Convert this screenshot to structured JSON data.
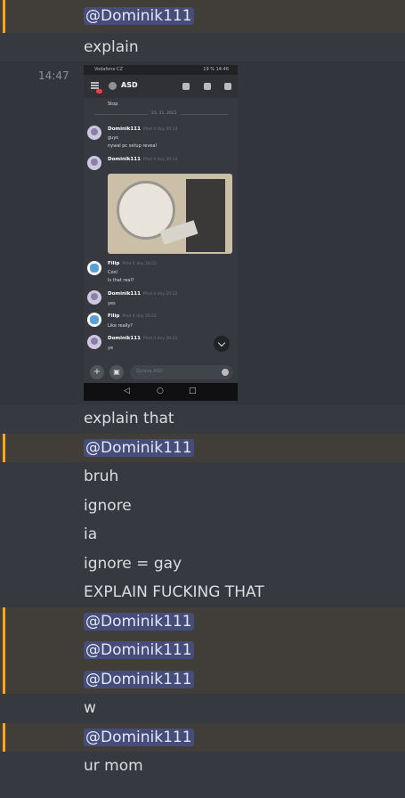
{
  "timestamp": "14:47",
  "messages": [
    {
      "text": "@Dominik111",
      "mention": true
    },
    {
      "text": "explain",
      "mention": false
    },
    {
      "text": "explain that",
      "mention": false
    },
    {
      "text": "@Dominik111",
      "mention": true
    },
    {
      "text": "bruh",
      "mention": false
    },
    {
      "text": "ignore",
      "mention": false
    },
    {
      "text": "ia",
      "mention": false
    },
    {
      "text": "ignore = gay",
      "mention": false
    },
    {
      "text": "EXPLAIN FUCKING THAT",
      "mention": false
    },
    {
      "text": "@Dominik111",
      "mention": true
    },
    {
      "text": "@Dominik111",
      "mention": true
    },
    {
      "text": "@Dominik111",
      "mention": true
    },
    {
      "text": "w",
      "mention": false
    },
    {
      "text": "@Dominik111",
      "mention": true
    },
    {
      "text": "ur mom",
      "mention": false
    }
  ],
  "screenshot": {
    "status_left": "Vodafone CZ",
    "status_right": "19 % 14:46",
    "channel": "ASD",
    "first_text": "Stop",
    "date_divider": "23. 11. 2021",
    "posts": [
      {
        "author": "Dominik111",
        "time": "Před 4 dny 20:14",
        "lines": [
          "guys",
          "nywal pc setup reveal"
        ],
        "color": "#ffffff"
      },
      {
        "author": "Dominik111",
        "time": "Před 4 dny 20:14",
        "lines": [],
        "color": "#ffffff"
      },
      {
        "author": "Filip",
        "time": "Před 4 dny 20:22",
        "lines": [
          "Cool",
          "Is that real?"
        ],
        "color": "#ffffff"
      },
      {
        "author": "Dominik111",
        "time": "Před 4 dny 20:22",
        "lines": [
          "yes"
        ],
        "color": "#ffffff"
      },
      {
        "author": "Filip",
        "time": "Před 4 dny 20:22",
        "lines": [
          "Like really?"
        ],
        "color": "#ffffff"
      },
      {
        "author": "Dominik111",
        "time": "Před 4 dny 20:22",
        "lines": [
          "ye"
        ],
        "color": "#ffffff"
      }
    ],
    "input_placeholder": "Zpráva ASD"
  }
}
